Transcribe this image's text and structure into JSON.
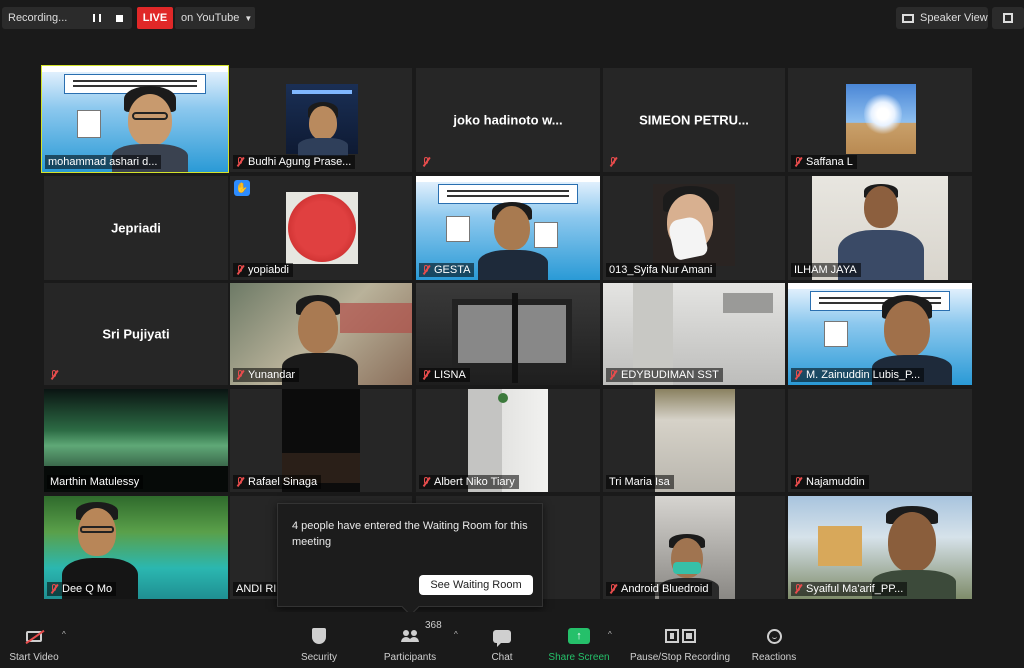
{
  "topbar": {
    "recording_label": "Recording...",
    "live_label": "LIVE",
    "youtube_label": "on YouTube",
    "speaker_view_label": "Speaker View"
  },
  "participants": [
    {
      "name": "mohammad ashari d...",
      "muted": true
    },
    {
      "name": "Budhi Agung Prase...",
      "muted": true
    },
    {
      "name": "joko hadinoto w...",
      "muted": true
    },
    {
      "name": "SIMEON PETRU...",
      "muted": true
    },
    {
      "name": "Saffana L",
      "muted": true
    },
    {
      "name": "Jepriadi",
      "muted": true
    },
    {
      "name": "yopiabdi",
      "muted": true
    },
    {
      "name": "GESTA",
      "muted": true
    },
    {
      "name": "013_Syifa Nur Amani",
      "muted": false
    },
    {
      "name": "ILHAM JAYA",
      "muted": false
    },
    {
      "name": "Sri Pujiyati",
      "muted": true
    },
    {
      "name": "Yunandar",
      "muted": true
    },
    {
      "name": "LISNA",
      "muted": true
    },
    {
      "name": "EDYBUDIMAN SST",
      "muted": true
    },
    {
      "name": "M. Zainuddin Lubis_P...",
      "muted": true
    },
    {
      "name": "Marthin Matulessy",
      "muted": false
    },
    {
      "name": "Rafael Sinaga",
      "muted": true
    },
    {
      "name": "Albert Niko Tiary",
      "muted": true
    },
    {
      "name": "Tri Maria Isa",
      "muted": false
    },
    {
      "name": "Najamuddin",
      "muted": true
    },
    {
      "name": "Dee Q Mo",
      "muted": true
    },
    {
      "name": "ANDI RI",
      "muted": false
    },
    {
      "name": "Android Bluedroid",
      "muted": true
    },
    {
      "name": "Syaiful Ma'arif_PP...",
      "muted": true
    }
  ],
  "notification": {
    "message": "4 people have entered the Waiting Room for this meeting",
    "button_label": "See Waiting Room"
  },
  "toolbar": {
    "start_video": "Start Video",
    "security": "Security",
    "participants": "Participants",
    "participant_count": "368",
    "chat": "Chat",
    "share_screen": "Share Screen",
    "pause_stop_recording": "Pause/Stop Recording",
    "reactions": "Reactions"
  },
  "colors": {
    "live_red": "#e02828",
    "share_green": "#25c06a",
    "active_speaker": "#d4e32b",
    "raise_hand_blue": "#2d8cff"
  }
}
